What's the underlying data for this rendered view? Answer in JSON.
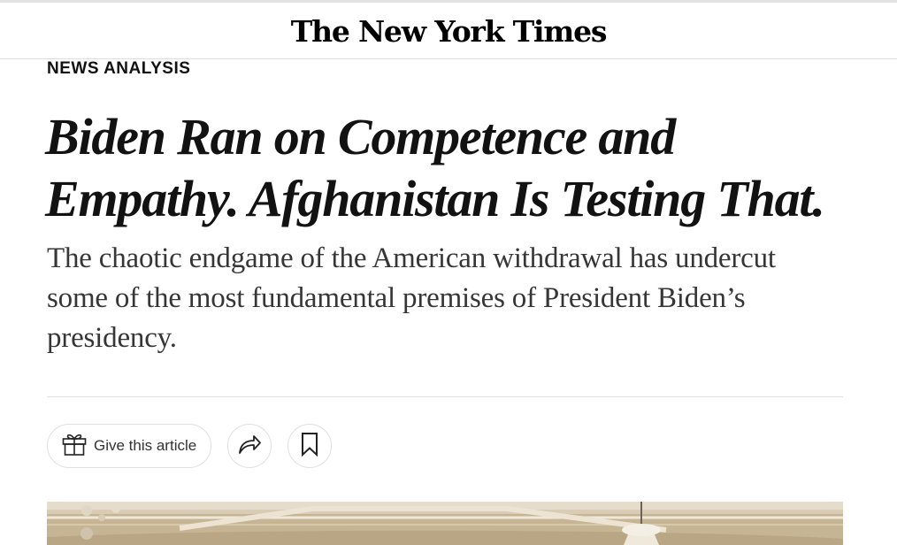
{
  "masthead": {
    "logo_text": "The New York Times"
  },
  "article": {
    "kicker": "NEWS ANALYSIS",
    "headline": "Biden Ran on Competence and Empathy. Afghanistan Is Testing That.",
    "summary": "The chaotic endgame of the American withdrawal has undercut some of the most fundamental premises of President Biden’s presidency."
  },
  "actions": {
    "gift_label": "Give this article",
    "gift_icon": "gift-icon",
    "share_icon": "share-icon",
    "save_icon": "bookmark-icon"
  },
  "photo": {
    "description_icon": "photo"
  }
}
